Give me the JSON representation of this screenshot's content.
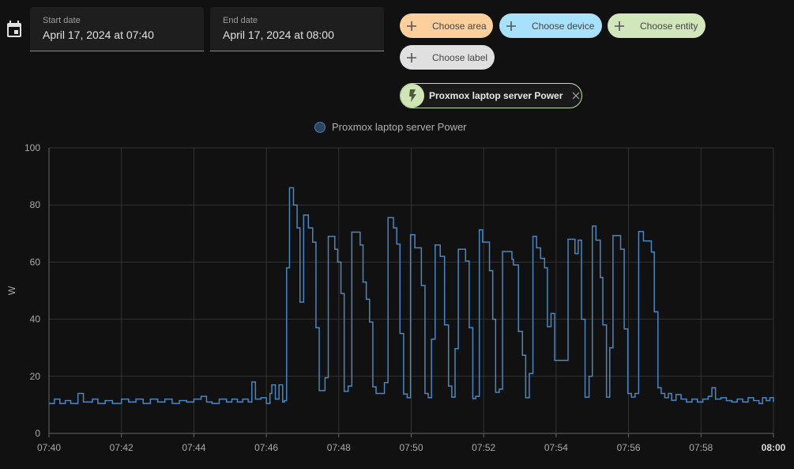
{
  "date_picker": {
    "start_label": "Start date",
    "start_value": "April 17, 2024 at 07:40",
    "end_label": "End date",
    "end_value": "April 17, 2024 at 08:00"
  },
  "target_picker": {
    "chips": [
      {
        "label": "Choose area",
        "color": "#fccf9c"
      },
      {
        "label": "Choose device",
        "color": "#a8e1fb"
      },
      {
        "label": "Choose entity",
        "color": "#d1e7bb"
      },
      {
        "label": "Choose label",
        "color": "#e0e0e0"
      }
    ],
    "selected_entity": {
      "name": "Proxmox laptop server Power",
      "icon": "flash-icon"
    }
  },
  "chart_data": {
    "type": "line",
    "step": true,
    "legend": [
      "Proxmox laptop server Power"
    ],
    "legend_placement": "top-center",
    "ylabel": "W",
    "ylim": [
      0,
      100
    ],
    "yticks": [
      "0",
      "20",
      "40",
      "60",
      "80",
      "100"
    ],
    "xlim_minutes": [
      0,
      20
    ],
    "xticks": [
      "07:40",
      "07:42",
      "07:44",
      "07:46",
      "07:48",
      "07:50",
      "07:52",
      "07:54",
      "07:56",
      "07:58",
      "08:00"
    ],
    "grid": true,
    "series": [
      {
        "name": "Proxmox laptop server Power",
        "color": "#4a86c0",
        "points_minutes_after_0740": [
          [
            0,
            10.5
          ],
          [
            0.15,
            12
          ],
          [
            0.3,
            10.5
          ],
          [
            0.45,
            11.5
          ],
          [
            0.6,
            10.5
          ],
          [
            0.8,
            14
          ],
          [
            0.95,
            11
          ],
          [
            1.2,
            12
          ],
          [
            1.35,
            10.5
          ],
          [
            1.55,
            11.5
          ],
          [
            1.75,
            10.5
          ],
          [
            2.0,
            12
          ],
          [
            2.2,
            11
          ],
          [
            2.4,
            12
          ],
          [
            2.6,
            10.5
          ],
          [
            2.8,
            12
          ],
          [
            3.0,
            11
          ],
          [
            3.2,
            12
          ],
          [
            3.4,
            10.5
          ],
          [
            3.6,
            11.5
          ],
          [
            3.8,
            11
          ],
          [
            4.0,
            12
          ],
          [
            4.2,
            13
          ],
          [
            4.35,
            11
          ],
          [
            4.5,
            10.5
          ],
          [
            4.7,
            12
          ],
          [
            4.9,
            11
          ],
          [
            5.05,
            12
          ],
          [
            5.2,
            11
          ],
          [
            5.35,
            12
          ],
          [
            5.5,
            11
          ],
          [
            5.6,
            18
          ],
          [
            5.7,
            12
          ],
          [
            5.85,
            12.5
          ],
          [
            6.0,
            10.5
          ],
          [
            6.1,
            14
          ],
          [
            6.15,
            17
          ],
          [
            6.25,
            12
          ],
          [
            6.35,
            17
          ],
          [
            6.45,
            11
          ],
          [
            6.5,
            11.5
          ],
          [
            6.56,
            58
          ],
          [
            6.64,
            86
          ],
          [
            6.75,
            80
          ],
          [
            6.85,
            72
          ],
          [
            6.93,
            46
          ],
          [
            7.03,
            76.5
          ],
          [
            7.16,
            72
          ],
          [
            7.28,
            67
          ],
          [
            7.37,
            37
          ],
          [
            7.46,
            15
          ],
          [
            7.62,
            19.5
          ],
          [
            7.71,
            69
          ],
          [
            7.89,
            64.5
          ],
          [
            7.97,
            60
          ],
          [
            8.06,
            49
          ],
          [
            8.15,
            14.7
          ],
          [
            8.26,
            16.6
          ],
          [
            8.36,
            70.5
          ],
          [
            8.59,
            66
          ],
          [
            8.67,
            53
          ],
          [
            8.76,
            47
          ],
          [
            8.85,
            39
          ],
          [
            8.94,
            16.3
          ],
          [
            9.03,
            14
          ],
          [
            9.26,
            17.8
          ],
          [
            9.36,
            75.6
          ],
          [
            9.51,
            72
          ],
          [
            9.6,
            66.3
          ],
          [
            9.69,
            35
          ],
          [
            9.79,
            13.8
          ],
          [
            9.89,
            12.5
          ],
          [
            9.98,
            69.6
          ],
          [
            10.1,
            65
          ],
          [
            10.28,
            51.8
          ],
          [
            10.38,
            14
          ],
          [
            10.47,
            12.5
          ],
          [
            10.56,
            33
          ],
          [
            10.66,
            66
          ],
          [
            10.8,
            62
          ],
          [
            10.92,
            38
          ],
          [
            11.03,
            16.6
          ],
          [
            11.12,
            12.7
          ],
          [
            11.21,
            29.7
          ],
          [
            11.3,
            64.5
          ],
          [
            11.5,
            60.4
          ],
          [
            11.6,
            37
          ],
          [
            11.7,
            12.2
          ],
          [
            11.78,
            13
          ],
          [
            11.88,
            71.3
          ],
          [
            11.97,
            67
          ],
          [
            12.16,
            57
          ],
          [
            12.25,
            40
          ],
          [
            12.33,
            14.4
          ],
          [
            12.43,
            15.5
          ],
          [
            12.52,
            63.7
          ],
          [
            12.78,
            61
          ],
          [
            12.82,
            59
          ],
          [
            12.96,
            35.7
          ],
          [
            13.07,
            27.4
          ],
          [
            13.16,
            12.5
          ],
          [
            13.26,
            21
          ],
          [
            13.36,
            69
          ],
          [
            13.46,
            65
          ],
          [
            13.57,
            61.3
          ],
          [
            13.68,
            58
          ],
          [
            13.76,
            37.4
          ],
          [
            13.86,
            42
          ],
          [
            13.96,
            25.6
          ],
          [
            14.33,
            68
          ],
          [
            14.52,
            63
          ],
          [
            14.61,
            67.7
          ],
          [
            14.7,
            40
          ],
          [
            14.8,
            12.7
          ],
          [
            14.91,
            20
          ],
          [
            15.0,
            72.6
          ],
          [
            15.1,
            67.7
          ],
          [
            15.22,
            54.6
          ],
          [
            15.29,
            38
          ],
          [
            15.39,
            12.7
          ],
          [
            15.48,
            30
          ],
          [
            15.57,
            69.3
          ],
          [
            15.78,
            64.5
          ],
          [
            15.88,
            36.6
          ],
          [
            15.98,
            14
          ],
          [
            16.08,
            12.7
          ],
          [
            16.18,
            14
          ],
          [
            16.28,
            70.7
          ],
          [
            16.41,
            67.4
          ],
          [
            16.63,
            63.5
          ],
          [
            16.71,
            42.6
          ],
          [
            16.81,
            16
          ],
          [
            16.9,
            14
          ],
          [
            17.0,
            12.5
          ],
          [
            17.1,
            14
          ],
          [
            17.19,
            11.6
          ],
          [
            17.31,
            13.6
          ],
          [
            17.45,
            12
          ],
          [
            17.6,
            11
          ],
          [
            17.75,
            12
          ],
          [
            17.9,
            11
          ],
          [
            18.05,
            12
          ],
          [
            18.2,
            13
          ],
          [
            18.3,
            16
          ],
          [
            18.4,
            12
          ],
          [
            18.55,
            12.5
          ],
          [
            18.7,
            11.5
          ],
          [
            18.85,
            11
          ],
          [
            19.0,
            12
          ],
          [
            19.15,
            11
          ],
          [
            19.3,
            12.5
          ],
          [
            19.45,
            11.5
          ],
          [
            19.6,
            10.5
          ],
          [
            19.7,
            12.5
          ],
          [
            19.8,
            11.5
          ],
          [
            19.9,
            12.5
          ],
          [
            20,
            11
          ]
        ]
      }
    ]
  }
}
